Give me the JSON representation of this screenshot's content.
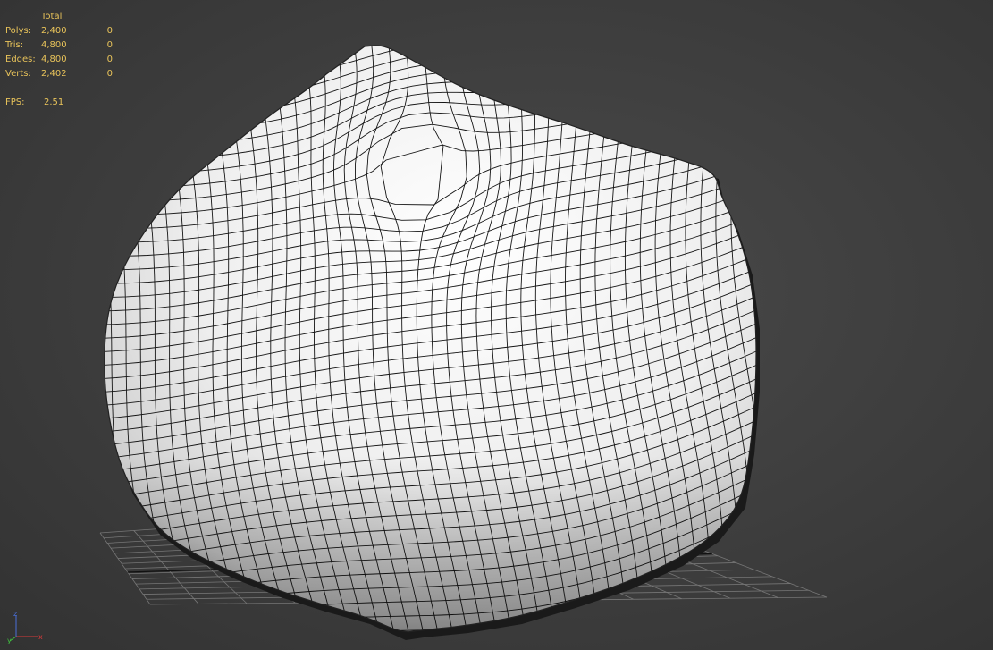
{
  "stats": {
    "header": "Total",
    "rows": [
      {
        "label": "Polys:",
        "total": "2,400",
        "selected": "0"
      },
      {
        "label": "Tris:",
        "total": "4,800",
        "selected": "0"
      },
      {
        "label": "Edges:",
        "total": "4,800",
        "selected": "0"
      },
      {
        "label": "Verts:",
        "total": "2,402",
        "selected": "0"
      }
    ],
    "fps_label": "FPS:",
    "fps_value": "2.51"
  },
  "gizmo": {
    "x": "x",
    "y": "y",
    "z": "z"
  },
  "colors": {
    "stats_text": "#e8c35a",
    "background": "#3d3d3d",
    "grid": "#777777",
    "mesh_fill": "#f0f0f0",
    "wire": "#111111"
  }
}
